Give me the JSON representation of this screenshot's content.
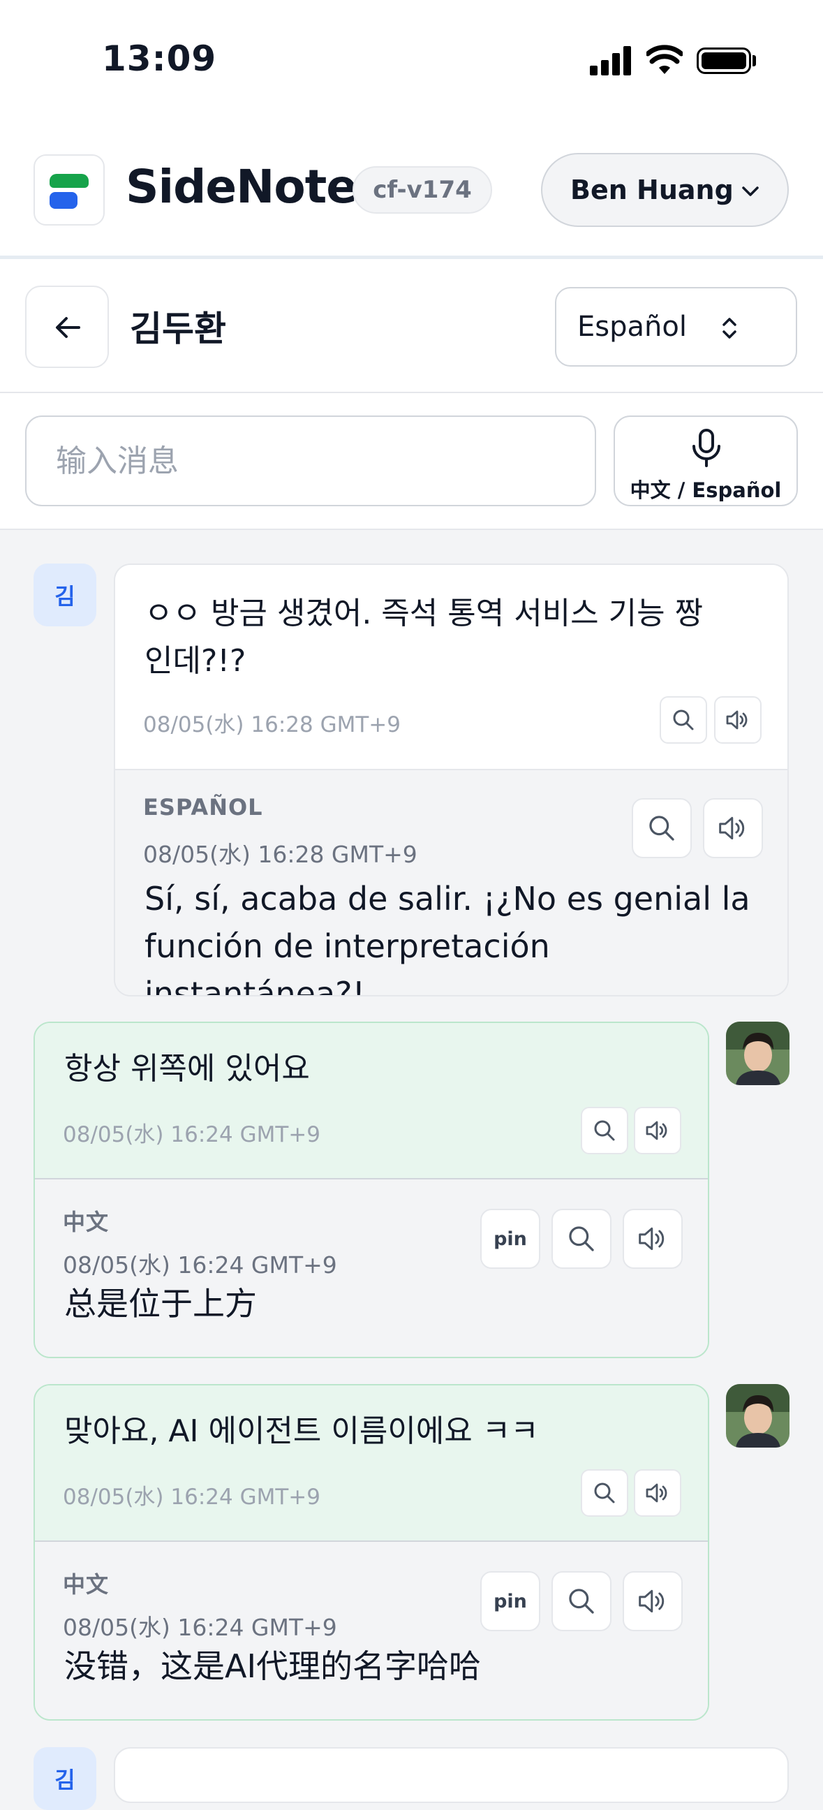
{
  "status_bar": {
    "time": "13:09"
  },
  "header": {
    "app_name": "SideNote",
    "version_badge": "cf-v174",
    "user_name": "Ben Huang"
  },
  "chat": {
    "contact_name": "김두환",
    "language_select": "Español"
  },
  "composer": {
    "placeholder": "输入消息",
    "mic_label": "中文 / Español"
  },
  "messages": [
    {
      "direction": "incoming",
      "avatar_label": "김",
      "original_text": "ㅇㅇ 방금 생겼어. 즉석 통역 서비스 기능 짱인데?!?",
      "original_timestamp": "08/05(水) 16:28 GMT+9",
      "translation_language": "ESPAÑOL",
      "translation_timestamp": "08/05(水) 16:28 GMT+9",
      "translation_text": "Sí, sí, acaba de salir. ¡¿No es genial la función de interpretación instantánea?!"
    },
    {
      "direction": "outgoing",
      "original_text": "항상 위쪽에 있어요",
      "original_timestamp": "08/05(水) 16:24 GMT+9",
      "translation_language": "中文",
      "translation_timestamp": "08/05(水) 16:24 GMT+9",
      "translation_text": "总是位于上方",
      "pin_label": "pin"
    },
    {
      "direction": "outgoing",
      "original_text": "맞아요, AI 에이전트 이름이에요 ㅋㅋ",
      "original_timestamp": "08/05(水) 16:24 GMT+9",
      "translation_language": "中文",
      "translation_timestamp": "08/05(水) 16:24 GMT+9",
      "translation_text": "没错，这是AI代理的名字哈哈",
      "pin_label": "pin"
    },
    {
      "direction": "incoming",
      "avatar_label": "김"
    }
  ],
  "colors": {
    "brand_green": "#16a34a",
    "brand_blue": "#2563eb",
    "outgoing_bubble": "#e8f6ee",
    "page_background": "#f3f4f6"
  },
  "icons": [
    "signal-icon",
    "wifi-icon",
    "battery-icon",
    "chevron-down-icon",
    "back-arrow-icon",
    "sort-updown-icon",
    "microphone-icon",
    "search-icon",
    "speaker-icon"
  ]
}
